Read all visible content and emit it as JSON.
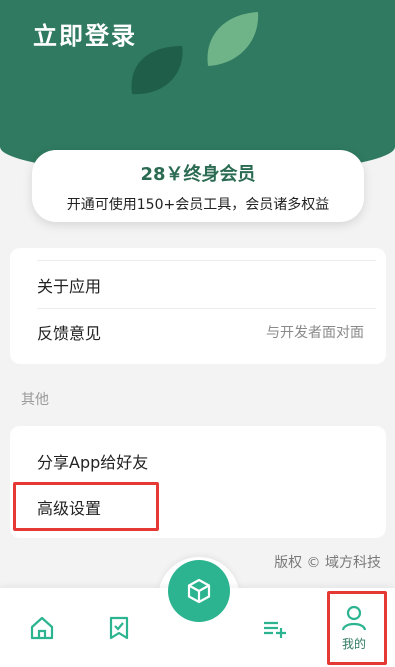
{
  "header": {
    "title": "立即登录",
    "bg_color": "#2f7a60"
  },
  "vip": {
    "title": "28￥终身会员",
    "subtitle": "开通可使用150+会员工具，会员诸多权益"
  },
  "settings": {
    "about": {
      "label": "关于应用"
    },
    "feedback": {
      "label": "反馈意见",
      "value": "与开发者面对面"
    }
  },
  "others": {
    "section_title": "其他",
    "share": {
      "label": "分享App给好友"
    },
    "advanced": {
      "label": "高级设置"
    }
  },
  "footer": {
    "copyright": "版权 © 域方科技"
  },
  "nav": {
    "items": [
      {
        "icon": "home-icon"
      },
      {
        "icon": "bookmark-check-icon"
      },
      {
        "icon": "cube-icon"
      },
      {
        "icon": "playlist-add-icon"
      },
      {
        "icon": "person-icon",
        "label": "我的"
      }
    ],
    "accent_color": "#2bb48f",
    "highlight_color": "#e53935"
  }
}
